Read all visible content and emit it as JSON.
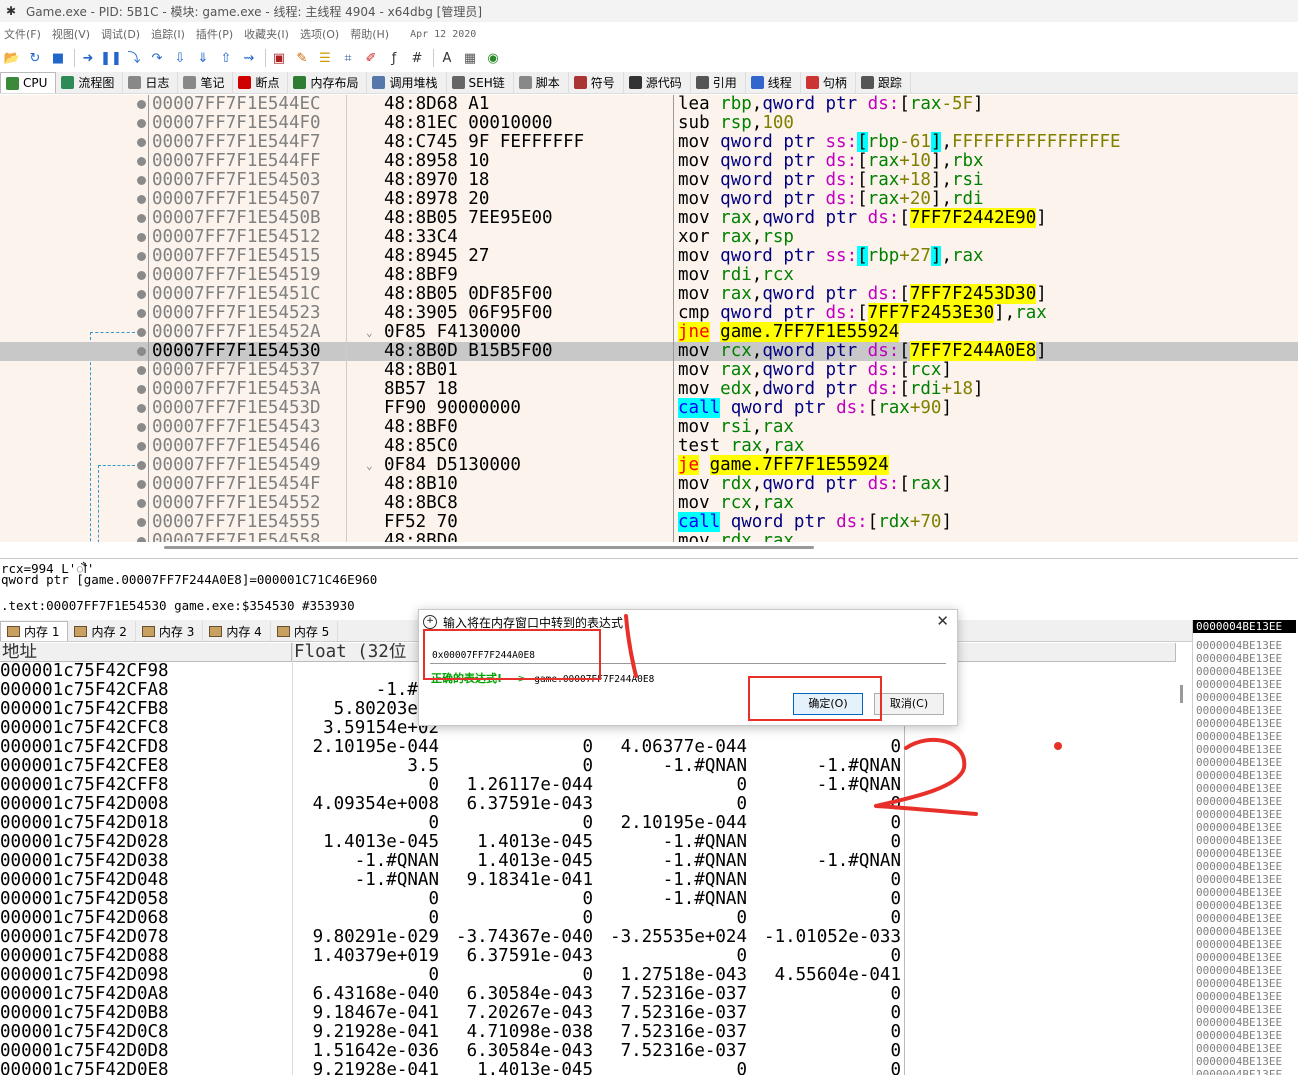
{
  "window": {
    "title": "Game.exe - PID: 5B1C - 模块: game.exe - 线程: 主线程 4904 - x64dbg [管理员]"
  },
  "menu": {
    "items": [
      "文件(F)",
      "视图(V)",
      "调试(D)",
      "追踪(I)",
      "插件(P)",
      "收藏夹(I)",
      "选项(O)",
      "帮助(H)"
    ],
    "date": "Apr 12 2020"
  },
  "toolbar": {
    "icons": [
      "open-icon",
      "restart-icon",
      "stop-icon",
      "run-icon",
      "pause-icon",
      "step-into-icon",
      "step-over-icon",
      "trace-into-icon",
      "trace-over-icon",
      "execute-till-return-icon",
      "run-to-user-code-icon",
      "breakpoint-icon",
      "patch-icon",
      "comment-icon",
      "label-icon",
      "bookmark-icon",
      "function-icon",
      "hash-icon",
      "font-icon",
      "calculator-icon",
      "globe-icon"
    ]
  },
  "tabs": [
    {
      "label": "CPU",
      "color": "#3a8a3a"
    },
    {
      "label": "流程图",
      "color": "#2e8b57"
    },
    {
      "label": "日志",
      "color": "#888888"
    },
    {
      "label": "笔记",
      "color": "#888888"
    },
    {
      "label": "断点",
      "color": "#d00000"
    },
    {
      "label": "内存布局",
      "color": "#2e7d32"
    },
    {
      "label": "调用堆栈",
      "color": "#5577aa"
    },
    {
      "label": "SEH链",
      "color": "#666666"
    },
    {
      "label": "脚本",
      "color": "#888888"
    },
    {
      "label": "符号",
      "color": "#aa3333"
    },
    {
      "label": "源代码",
      "color": "#333333"
    },
    {
      "label": "引用",
      "color": "#555555"
    },
    {
      "label": "线程",
      "color": "#3366cc"
    },
    {
      "label": "句柄",
      "color": "#cc3333"
    },
    {
      "label": "跟踪",
      "color": "#555555"
    }
  ],
  "disasm": {
    "rows": [
      {
        "addr": "00007FF7F1E544EC",
        "bytes": "48:8D68 A1",
        "asm": [
          [
            "lea ",
            ""
          ],
          [
            "rbp",
            "reg"
          ],
          [
            ",",
            ""
          ],
          [
            "qword ptr ",
            "sz"
          ],
          [
            "ds:",
            "seg"
          ],
          [
            "[",
            ""
          ],
          [
            "rax",
            "reg"
          ],
          [
            "-5F",
            "num"
          ],
          [
            "]",
            ""
          ]
        ]
      },
      {
        "addr": "00007FF7F1E544F0",
        "bytes": "48:81EC 00010000",
        "asm": [
          [
            "sub ",
            ""
          ],
          [
            "rsp",
            "reg"
          ],
          [
            ",",
            ""
          ],
          [
            "100",
            "num"
          ]
        ]
      },
      {
        "addr": "00007FF7F1E544F7",
        "bytes": "48:C745 9F FEFFFFFF",
        "asm": [
          [
            "mov ",
            ""
          ],
          [
            "qword ptr ",
            "sz"
          ],
          [
            "ss:",
            "seg"
          ],
          [
            "[",
            "hlc"
          ],
          [
            "rbp",
            "reg"
          ],
          [
            "-61",
            "num"
          ],
          [
            "]",
            "hlc"
          ],
          [
            ",",
            ""
          ],
          [
            "FFFFFFFFFFFFFFFE",
            "num"
          ]
        ]
      },
      {
        "addr": "00007FF7F1E544FF",
        "bytes": "48:8958 10",
        "asm": [
          [
            "mov ",
            ""
          ],
          [
            "qword ptr ",
            "sz"
          ],
          [
            "ds:",
            "seg"
          ],
          [
            "[",
            ""
          ],
          [
            "rax",
            "reg"
          ],
          [
            "+10",
            "num"
          ],
          [
            "]",
            ""
          ],
          [
            ",",
            ""
          ],
          [
            "rbx",
            "reg"
          ]
        ]
      },
      {
        "addr": "00007FF7F1E54503",
        "bytes": "48:8970 18",
        "asm": [
          [
            "mov ",
            ""
          ],
          [
            "qword ptr ",
            "sz"
          ],
          [
            "ds:",
            "seg"
          ],
          [
            "[",
            ""
          ],
          [
            "rax",
            "reg"
          ],
          [
            "+18",
            "num"
          ],
          [
            "]",
            ""
          ],
          [
            ",",
            ""
          ],
          [
            "rsi",
            "reg"
          ]
        ]
      },
      {
        "addr": "00007FF7F1E54507",
        "bytes": "48:8978 20",
        "asm": [
          [
            "mov ",
            ""
          ],
          [
            "qword ptr ",
            "sz"
          ],
          [
            "ds:",
            "seg"
          ],
          [
            "[",
            ""
          ],
          [
            "rax",
            "reg"
          ],
          [
            "+20",
            "num"
          ],
          [
            "]",
            ""
          ],
          [
            ",",
            ""
          ],
          [
            "rdi",
            "reg"
          ]
        ]
      },
      {
        "addr": "00007FF7F1E5450B",
        "bytes": "48:8B05 7EE95E00",
        "asm": [
          [
            "mov ",
            ""
          ],
          [
            "rax",
            "reg"
          ],
          [
            ",",
            ""
          ],
          [
            "qword ptr ",
            "sz"
          ],
          [
            "ds:",
            "seg"
          ],
          [
            "[",
            ""
          ],
          [
            "7FF7F2442E90",
            "hly"
          ],
          [
            "]",
            ""
          ]
        ]
      },
      {
        "addr": "00007FF7F1E54512",
        "bytes": "48:33C4",
        "asm": [
          [
            "xor ",
            ""
          ],
          [
            "rax",
            "reg"
          ],
          [
            ",",
            ""
          ],
          [
            "rsp",
            "reg"
          ]
        ]
      },
      {
        "addr": "00007FF7F1E54515",
        "bytes": "48:8945 27",
        "asm": [
          [
            "mov ",
            ""
          ],
          [
            "qword ptr ",
            "sz"
          ],
          [
            "ss:",
            "seg"
          ],
          [
            "[",
            "hlc"
          ],
          [
            "rbp",
            "reg"
          ],
          [
            "+27",
            "num"
          ],
          [
            "]",
            "hlc"
          ],
          [
            ",",
            ""
          ],
          [
            "rax",
            "reg"
          ]
        ]
      },
      {
        "addr": "00007FF7F1E54519",
        "bytes": "48:8BF9",
        "asm": [
          [
            "mov ",
            ""
          ],
          [
            "rdi",
            "reg"
          ],
          [
            ",",
            ""
          ],
          [
            "rcx",
            "reg"
          ]
        ]
      },
      {
        "addr": "00007FF7F1E5451C",
        "bytes": "48:8B05 0DF85F00",
        "asm": [
          [
            "mov ",
            ""
          ],
          [
            "rax",
            "reg"
          ],
          [
            ",",
            ""
          ],
          [
            "qword ptr ",
            "sz"
          ],
          [
            "ds:",
            "seg"
          ],
          [
            "[",
            ""
          ],
          [
            "7FF7F2453D30",
            "hly"
          ],
          [
            "]",
            ""
          ]
        ]
      },
      {
        "addr": "00007FF7F1E54523",
        "bytes": "48:3905 06F95F00",
        "asm": [
          [
            "cmp ",
            ""
          ],
          [
            "qword ptr ",
            "sz"
          ],
          [
            "ds:",
            "seg"
          ],
          [
            "[",
            ""
          ],
          [
            "7FF7F2453E30",
            "hly"
          ],
          [
            "]",
            ""
          ],
          [
            ",",
            ""
          ],
          [
            "rax",
            "reg"
          ]
        ]
      },
      {
        "addr": "00007FF7F1E5452A",
        "bytes": "0F85 F4130000",
        "arrow": "⌄",
        "asm": [
          [
            "jne",
            "jmp"
          ],
          [
            " ",
            ""
          ],
          [
            "game.7FF7F1E55924",
            "hly"
          ]
        ]
      },
      {
        "addr": "00007FF7F1E54530",
        "bytes": "48:8B0D B15B5F00",
        "selected": true,
        "asm": [
          [
            "mov ",
            ""
          ],
          [
            "rcx",
            "reg"
          ],
          [
            ",",
            ""
          ],
          [
            "qword ptr ",
            "sz"
          ],
          [
            "ds:",
            "seg"
          ],
          [
            "[",
            ""
          ],
          [
            "7FF7F244A0E8",
            "hly"
          ],
          [
            "]",
            ""
          ]
        ]
      },
      {
        "addr": "00007FF7F1E54537",
        "bytes": "48:8B01",
        "asm": [
          [
            "mov ",
            ""
          ],
          [
            "rax",
            "reg"
          ],
          [
            ",",
            ""
          ],
          [
            "qword ptr ",
            "sz"
          ],
          [
            "ds:",
            "seg"
          ],
          [
            "[",
            ""
          ],
          [
            "rcx",
            "reg"
          ],
          [
            "]",
            ""
          ]
        ]
      },
      {
        "addr": "00007FF7F1E5453A",
        "bytes": "8B57 18",
        "asm": [
          [
            "mov ",
            ""
          ],
          [
            "edx",
            "reg"
          ],
          [
            ",",
            ""
          ],
          [
            "dword ptr ",
            "sz"
          ],
          [
            "ds:",
            "seg"
          ],
          [
            "[",
            ""
          ],
          [
            "rdi",
            "reg"
          ],
          [
            "+18",
            "num"
          ],
          [
            "]",
            ""
          ]
        ]
      },
      {
        "addr": "00007FF7F1E5453D",
        "bytes": "FF90 90000000",
        "asm": [
          [
            "call",
            "call"
          ],
          [
            " ",
            ""
          ],
          [
            "qword ptr ",
            "sz"
          ],
          [
            "ds:",
            "seg"
          ],
          [
            "[",
            ""
          ],
          [
            "rax",
            "reg"
          ],
          [
            "+90",
            "num"
          ],
          [
            "]",
            ""
          ]
        ]
      },
      {
        "addr": "00007FF7F1E54543",
        "bytes": "48:8BF0",
        "asm": [
          [
            "mov ",
            ""
          ],
          [
            "rsi",
            "reg"
          ],
          [
            ",",
            ""
          ],
          [
            "rax",
            "reg"
          ]
        ]
      },
      {
        "addr": "00007FF7F1E54546",
        "bytes": "48:85C0",
        "asm": [
          [
            "test ",
            ""
          ],
          [
            "rax",
            "reg"
          ],
          [
            ",",
            ""
          ],
          [
            "rax",
            "reg"
          ]
        ]
      },
      {
        "addr": "00007FF7F1E54549",
        "bytes": "0F84 D5130000",
        "arrow": "⌄",
        "asm": [
          [
            "je",
            "jmp"
          ],
          [
            " ",
            ""
          ],
          [
            "game.7FF7F1E55924",
            "hly"
          ]
        ]
      },
      {
        "addr": "00007FF7F1E5454F",
        "bytes": "48:8B10",
        "asm": [
          [
            "mov ",
            ""
          ],
          [
            "rdx",
            "reg"
          ],
          [
            ",",
            ""
          ],
          [
            "qword ptr ",
            "sz"
          ],
          [
            "ds:",
            "seg"
          ],
          [
            "[",
            ""
          ],
          [
            "rax",
            "reg"
          ],
          [
            "]",
            ""
          ]
        ]
      },
      {
        "addr": "00007FF7F1E54552",
        "bytes": "48:8BC8",
        "asm": [
          [
            "mov ",
            ""
          ],
          [
            "rcx",
            "reg"
          ],
          [
            ",",
            ""
          ],
          [
            "rax",
            "reg"
          ]
        ]
      },
      {
        "addr": "00007FF7F1E54555",
        "bytes": "FF52 70",
        "asm": [
          [
            "call",
            "call"
          ],
          [
            " ",
            ""
          ],
          [
            "qword ptr ",
            "sz"
          ],
          [
            "ds:",
            "seg"
          ],
          [
            "[",
            ""
          ],
          [
            "rdx",
            "reg"
          ],
          [
            "+70",
            "num"
          ],
          [
            "]",
            ""
          ]
        ]
      },
      {
        "addr": "00007FF7F1E54558",
        "bytes": "48:8BD0",
        "asm": [
          [
            "mov ",
            ""
          ],
          [
            "rdx",
            "reg"
          ],
          [
            ",",
            ""
          ],
          [
            "rax",
            "reg"
          ]
        ]
      }
    ]
  },
  "info": {
    "line1": "rcx=994 L'ॏ'",
    "line2": "qword ptr [game.00007FF7F244A0E8]=000001C71C46E960",
    "line3": ".text:00007FF7F1E54530 game.exe:$354530 #353930"
  },
  "dump_tabs": [
    "内存 1",
    "内存 2",
    "内存 3",
    "内存 4",
    "内存 5"
  ],
  "dump": {
    "col_addr": "地址",
    "col_float": "Float (32位",
    "rows": [
      {
        "addr": "000001c75F42CF98",
        "v": [
          "",
          "",
          "",
          ""
        ]
      },
      {
        "addr": "000001c75F42CFA8",
        "v": [
          "-1.#QN",
          "",
          "",
          ""
        ]
      },
      {
        "addr": "000001c75F42CFB8",
        "v": [
          "5.80203e-0",
          "",
          "",
          ""
        ]
      },
      {
        "addr": "000001c75F42CFC8",
        "v": [
          "3.59154e+02",
          "",
          "",
          ""
        ]
      },
      {
        "addr": "000001c75F42CFD8",
        "v": [
          "2.10195e-044",
          "0",
          "4.06377e-044",
          "0"
        ]
      },
      {
        "addr": "000001c75F42CFE8",
        "v": [
          "3.5",
          "0",
          "-1.#QNAN",
          "-1.#QNAN"
        ]
      },
      {
        "addr": "000001c75F42CFF8",
        "v": [
          "0",
          "1.26117e-044",
          "0",
          "-1.#QNAN"
        ]
      },
      {
        "addr": "000001c75F42D008",
        "v": [
          "4.09354e+008",
          "6.37591e-043",
          "0",
          "0"
        ]
      },
      {
        "addr": "000001c75F42D018",
        "v": [
          "0",
          "0",
          "2.10195e-044",
          "0"
        ]
      },
      {
        "addr": "000001c75F42D028",
        "v": [
          "1.4013e-045",
          "1.4013e-045",
          "-1.#QNAN",
          "0"
        ]
      },
      {
        "addr": "000001c75F42D038",
        "v": [
          "-1.#QNAN",
          "1.4013e-045",
          "-1.#QNAN",
          "-1.#QNAN"
        ]
      },
      {
        "addr": "000001c75F42D048",
        "v": [
          "-1.#QNAN",
          "9.18341e-041",
          "-1.#QNAN",
          "0"
        ]
      },
      {
        "addr": "000001c75F42D058",
        "v": [
          "0",
          "0",
          "-1.#QNAN",
          "0"
        ]
      },
      {
        "addr": "000001c75F42D068",
        "v": [
          "0",
          "0",
          "0",
          "0"
        ]
      },
      {
        "addr": "000001c75F42D078",
        "v": [
          "9.80291e-029",
          "-3.74367e-040",
          "-3.25535e+024",
          "-1.01052e-033"
        ]
      },
      {
        "addr": "000001c75F42D088",
        "v": [
          "1.40379e+019",
          "6.37591e-043",
          "0",
          "0"
        ]
      },
      {
        "addr": "000001c75F42D098",
        "v": [
          "0",
          "0",
          "1.27518e-043",
          "4.55604e-041"
        ]
      },
      {
        "addr": "000001c75F42D0A8",
        "v": [
          "6.43168e-040",
          "6.30584e-043",
          "7.52316e-037",
          "0"
        ]
      },
      {
        "addr": "000001c75F42D0B8",
        "v": [
          "9.18467e-041",
          "7.20267e-043",
          "7.52316e-037",
          "0"
        ]
      },
      {
        "addr": "000001c75F42D0C8",
        "v": [
          "9.21928e-041",
          "4.71098e-038",
          "7.52316e-037",
          "0"
        ]
      },
      {
        "addr": "000001c75F42D0D8",
        "v": [
          "1.51642e-036",
          "6.30584e-043",
          "7.52316e-037",
          "0"
        ]
      },
      {
        "addr": "000001c75F42D0E8",
        "v": [
          "9.21928e-041",
          "1.4013e-045",
          "0",
          "0"
        ]
      }
    ]
  },
  "stack": {
    "rows": [
      "0000004BE13EE",
      "0000004BE13EE",
      "0000004BE13EE",
      "0000004BE13EE",
      "0000004BE13EE",
      "0000004BE13EE",
      "0000004BE13EE",
      "0000004BE13EE",
      "0000004BE13EE",
      "0000004BE13EE",
      "0000004BE13EE",
      "0000004BE13EE",
      "0000004BE13EE",
      "0000004BE13EE",
      "0000004BE13EE",
      "0000004BE13EE",
      "0000004BE13EE",
      "0000004BE13EE",
      "0000004BE13EE",
      "0000004BE13EE",
      "0000004BE13EE",
      "0000004BE13EE",
      "0000004BE13EE",
      "0000004BE13EE",
      "0000004BE13EE",
      "0000004BE13EE",
      "0000004BE13EE",
      "0000004BE13EE",
      "0000004BE13EE",
      "0000004BE13EE",
      "0000004BE13EE",
      "0000004BE13EE",
      "0000004BE13EE",
      "0000004BE13EE",
      "0000004BE13EE"
    ]
  },
  "dialog": {
    "title": "输入将在内存窗口中转到的表达式",
    "close": "✕",
    "expression": "0x00007FF7F244A0E8",
    "valid_label": "正确的表达式!",
    "arrow": "->",
    "result": "game.00007FF7F244A0E8",
    "ok_label": "确定(O)",
    "cancel_label": "取消(C)"
  }
}
